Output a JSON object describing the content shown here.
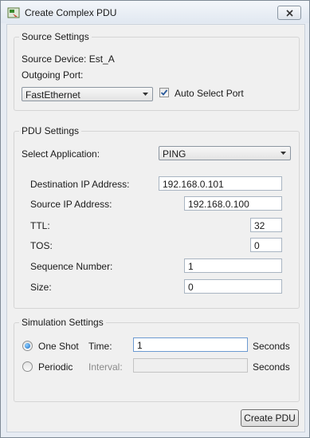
{
  "window": {
    "title": "Create Complex PDU",
    "icon": "packet-tracer-icon"
  },
  "source_settings": {
    "legend": "Source Settings",
    "source_device_label": "Source Device: Est_A",
    "outgoing_port_label": "Outgoing Port:",
    "outgoing_port_value": "FastEthernet",
    "auto_select_label": "Auto Select Port",
    "auto_select_checked": true
  },
  "pdu_settings": {
    "legend": "PDU Settings",
    "select_application_label": "Select Application:",
    "application_value": "PING",
    "destination_ip_label": "Destination IP Address:",
    "destination_ip_value": "192.168.0.101",
    "source_ip_label": "Source IP Address:",
    "source_ip_value": "192.168.0.100",
    "ttl_label": "TTL:",
    "ttl_value": "32",
    "tos_label": "TOS:",
    "tos_value": "0",
    "sequence_number_label": "Sequence Number:",
    "sequence_number_value": "1",
    "size_label": "Size:",
    "size_value": "0"
  },
  "simulation_settings": {
    "legend": "Simulation Settings",
    "one_shot_label": "One Shot",
    "time_label": "Time:",
    "time_value": "1",
    "time_unit": "Seconds",
    "periodic_label": "Periodic",
    "interval_label": "Interval:",
    "interval_value": "",
    "interval_unit": "Seconds",
    "mode": "one_shot"
  },
  "create_button_label": "Create PDU",
  "colors": {
    "radio_selected": "#1b6dc4",
    "checkbox_check": "#2a5a9a"
  }
}
